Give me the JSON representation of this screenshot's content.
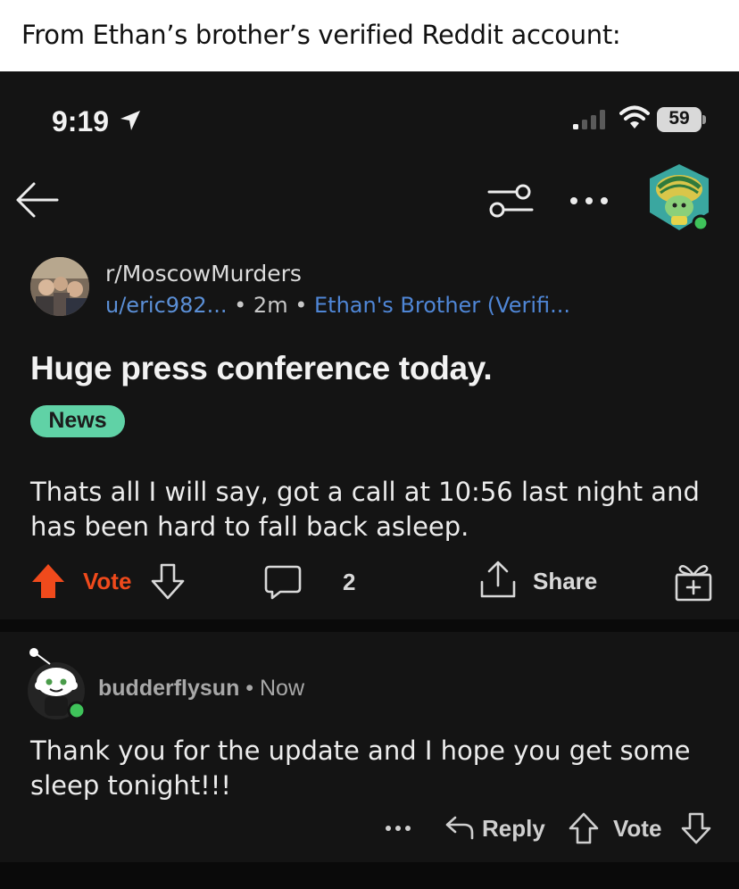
{
  "caption": "From Ethan’s brother’s verified Reddit account:",
  "status_bar": {
    "time": "9:19",
    "battery_level": "59"
  },
  "post": {
    "subreddit": "r/MoscowMurders",
    "author": "u/eric982...",
    "separator": " • ",
    "age": "2m",
    "author_flair": "Ethan's Brother (Verifi...",
    "title": "Huge press conference today.",
    "flair": "News",
    "body": "Thats all I will say, got a call at 10:56 last night and has been hard to fall back asleep.",
    "vote_label": "Vote",
    "comment_count": "2",
    "share_label": "Share"
  },
  "comment": {
    "author": "budderflysun",
    "separator": " • ",
    "age": "Now",
    "body": "Thank you for the update and I hope you get some sleep tonight!!!",
    "reply_label": "Reply",
    "vote_label": "Vote"
  },
  "colors": {
    "background": "#141414",
    "upvote_orange": "#f04a1c",
    "link_blue": "#5b8fd6",
    "flair_green": "#60d2a6",
    "online_green": "#3fc35a"
  },
  "icons": [
    "location-arrow-icon",
    "cellular-signal-icon",
    "wifi-icon",
    "battery-icon",
    "back-arrow-icon",
    "sort-filter-icon",
    "more-options-icon",
    "upvote-icon",
    "downvote-icon",
    "comment-icon",
    "share-icon",
    "award-icon",
    "reply-icon"
  ]
}
